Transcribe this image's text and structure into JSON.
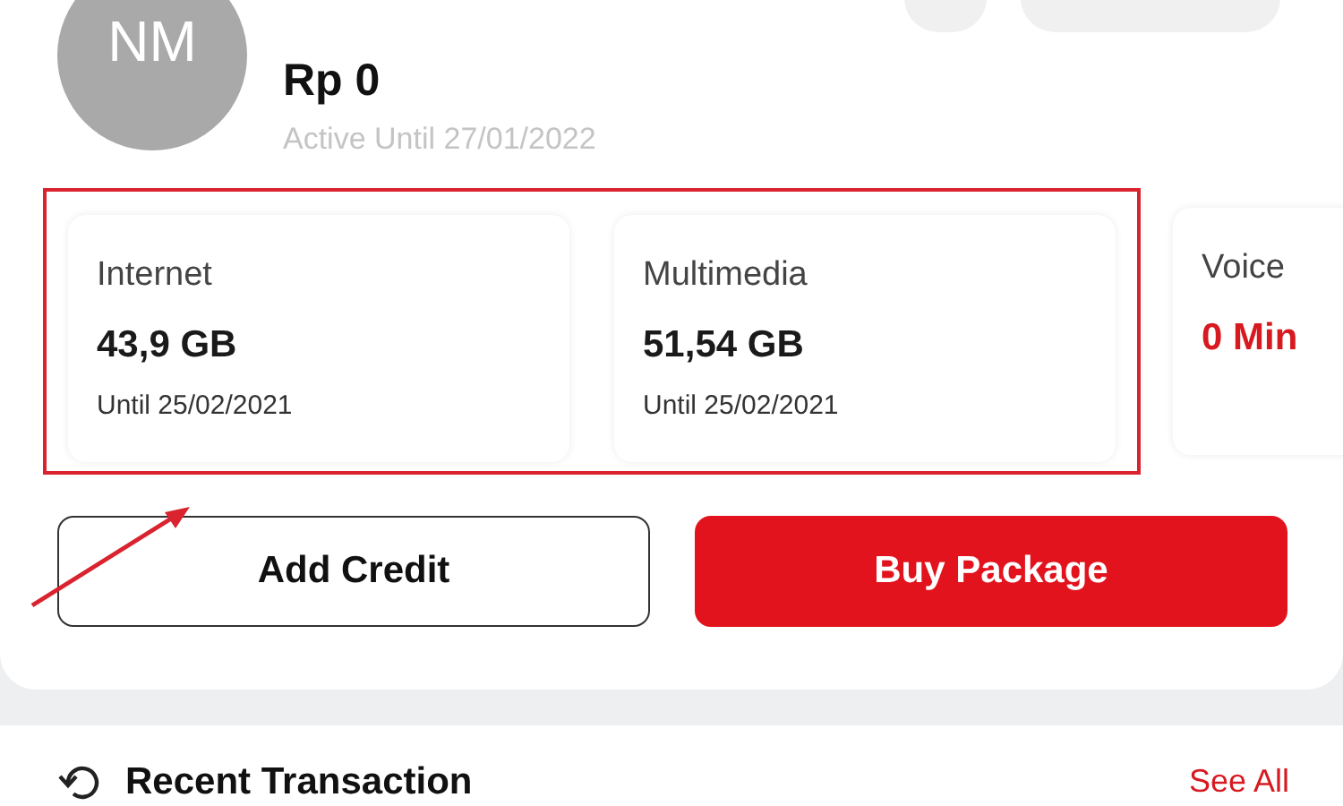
{
  "profile": {
    "initials": "NM",
    "balance": "Rp 0",
    "active_until": "Active Until 27/01/2022"
  },
  "packages": [
    {
      "name": "Internet",
      "amount": "43,9 GB",
      "until": "Until 25/02/2021",
      "color": "#1a1a1a",
      "highlighted": true
    },
    {
      "name": "Multimedia",
      "amount": "51,54 GB",
      "until": "Until 25/02/2021",
      "color": "#1a1a1a",
      "highlighted": true
    },
    {
      "name": "Voice",
      "amount": "0 Min",
      "color": "#d71920",
      "highlighted": false
    }
  ],
  "buttons": [
    {
      "label": "Add Credit",
      "kind": "outline"
    },
    {
      "label": "Buy Package",
      "kind": "primary"
    }
  ],
  "recent": {
    "title": "Recent Transaction",
    "link": "See All"
  }
}
